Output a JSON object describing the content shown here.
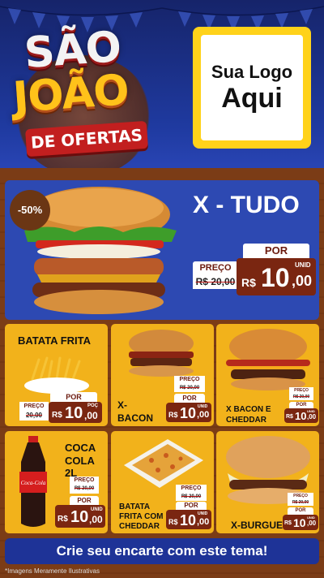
{
  "header": {
    "title_line1": "SÃO",
    "title_line2": "JOÃO",
    "title_line3": "DE OFERTAS",
    "logo_line1": "Sua Logo",
    "logo_line2": "Aqui"
  },
  "hero": {
    "discount": "-50%",
    "name": "X - TUDO",
    "por_label": "POR",
    "preco_label": "PREÇO",
    "old_price": "R$ 20,00",
    "currency": "R$",
    "price_int": "10",
    "price_dec": ",00",
    "unit": "UNID"
  },
  "products": [
    {
      "name": "BATATA FRITA",
      "preco_label": "PREÇO",
      "old_price": "20,00",
      "por_label": "POR",
      "currency": "R$",
      "price_int": "10",
      "price_dec": ",00",
      "unit": "POÇ"
    },
    {
      "name_line1": "X-",
      "name_line2": "BACON",
      "preco_label": "PREÇO",
      "old_price": "R$ 20,00",
      "por_label": "POR",
      "currency": "R$",
      "price_int": "10",
      "price_dec": ",00",
      "unit": "UNID"
    },
    {
      "name_line1": "X BACON E",
      "name_line2": "CHEDDAR",
      "preco_label": "PREÇO",
      "old_price": "R$ 20,00",
      "por_label": "POR",
      "currency": "R$",
      "price_int": "10",
      "price_dec": ",00",
      "unit": "UNID"
    },
    {
      "name_line1": "COCA",
      "name_line2": "COLA 2L",
      "preco_label": "PREÇO",
      "old_price": "R$ 20,00",
      "por_label": "POR",
      "currency": "R$",
      "price_int": "10",
      "price_dec": ",00",
      "unit": "UNID"
    },
    {
      "name_line1": "BATATA",
      "name_line2": "FRITA COM",
      "name_line3": "CHEDDAR",
      "preco_label": "PREÇO",
      "old_price": "R$ 20,00",
      "por_label": "POR",
      "currency": "R$",
      "price_int": "10",
      "price_dec": ",00",
      "unit": "UNID"
    },
    {
      "name": "X-BURGUER",
      "preco_label": "PREÇO",
      "old_price": "R$ 20,00",
      "por_label": "POR",
      "currency": "R$",
      "price_int": "10",
      "price_dec": ",00",
      "unit": "UNID"
    }
  ],
  "bottle_brand": "Coca-Cola",
  "footer": {
    "cta": "Crie seu encarte com este tema!",
    "disclaimer": "*Imagens Meramente Ilustrativas"
  },
  "colors": {
    "background_blue": "#2d49b2",
    "wood_brown": "#7b3c16",
    "card_yellow": "#f2b21b",
    "price_red": "#7a2611",
    "logo_yellow": "#ffd21a"
  }
}
